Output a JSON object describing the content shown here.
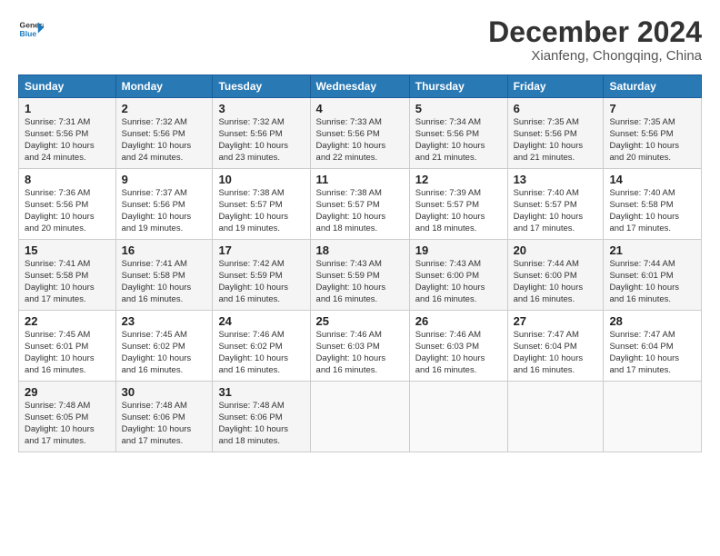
{
  "header": {
    "logo_line1": "General",
    "logo_line2": "Blue",
    "month": "December 2024",
    "location": "Xianfeng, Chongqing, China"
  },
  "days_of_week": [
    "Sunday",
    "Monday",
    "Tuesday",
    "Wednesday",
    "Thursday",
    "Friday",
    "Saturday"
  ],
  "weeks": [
    [
      {
        "day": "1",
        "lines": [
          "Sunrise: 7:31 AM",
          "Sunset: 5:56 PM",
          "Daylight: 10 hours",
          "and 24 minutes."
        ]
      },
      {
        "day": "2",
        "lines": [
          "Sunrise: 7:32 AM",
          "Sunset: 5:56 PM",
          "Daylight: 10 hours",
          "and 24 minutes."
        ]
      },
      {
        "day": "3",
        "lines": [
          "Sunrise: 7:32 AM",
          "Sunset: 5:56 PM",
          "Daylight: 10 hours",
          "and 23 minutes."
        ]
      },
      {
        "day": "4",
        "lines": [
          "Sunrise: 7:33 AM",
          "Sunset: 5:56 PM",
          "Daylight: 10 hours",
          "and 22 minutes."
        ]
      },
      {
        "day": "5",
        "lines": [
          "Sunrise: 7:34 AM",
          "Sunset: 5:56 PM",
          "Daylight: 10 hours",
          "and 21 minutes."
        ]
      },
      {
        "day": "6",
        "lines": [
          "Sunrise: 7:35 AM",
          "Sunset: 5:56 PM",
          "Daylight: 10 hours",
          "and 21 minutes."
        ]
      },
      {
        "day": "7",
        "lines": [
          "Sunrise: 7:35 AM",
          "Sunset: 5:56 PM",
          "Daylight: 10 hours",
          "and 20 minutes."
        ]
      }
    ],
    [
      {
        "day": "8",
        "lines": [
          "Sunrise: 7:36 AM",
          "Sunset: 5:56 PM",
          "Daylight: 10 hours",
          "and 20 minutes."
        ]
      },
      {
        "day": "9",
        "lines": [
          "Sunrise: 7:37 AM",
          "Sunset: 5:56 PM",
          "Daylight: 10 hours",
          "and 19 minutes."
        ]
      },
      {
        "day": "10",
        "lines": [
          "Sunrise: 7:38 AM",
          "Sunset: 5:57 PM",
          "Daylight: 10 hours",
          "and 19 minutes."
        ]
      },
      {
        "day": "11",
        "lines": [
          "Sunrise: 7:38 AM",
          "Sunset: 5:57 PM",
          "Daylight: 10 hours",
          "and 18 minutes."
        ]
      },
      {
        "day": "12",
        "lines": [
          "Sunrise: 7:39 AM",
          "Sunset: 5:57 PM",
          "Daylight: 10 hours",
          "and 18 minutes."
        ]
      },
      {
        "day": "13",
        "lines": [
          "Sunrise: 7:40 AM",
          "Sunset: 5:57 PM",
          "Daylight: 10 hours",
          "and 17 minutes."
        ]
      },
      {
        "day": "14",
        "lines": [
          "Sunrise: 7:40 AM",
          "Sunset: 5:58 PM",
          "Daylight: 10 hours",
          "and 17 minutes."
        ]
      }
    ],
    [
      {
        "day": "15",
        "lines": [
          "Sunrise: 7:41 AM",
          "Sunset: 5:58 PM",
          "Daylight: 10 hours",
          "and 17 minutes."
        ]
      },
      {
        "day": "16",
        "lines": [
          "Sunrise: 7:41 AM",
          "Sunset: 5:58 PM",
          "Daylight: 10 hours",
          "and 16 minutes."
        ]
      },
      {
        "day": "17",
        "lines": [
          "Sunrise: 7:42 AM",
          "Sunset: 5:59 PM",
          "Daylight: 10 hours",
          "and 16 minutes."
        ]
      },
      {
        "day": "18",
        "lines": [
          "Sunrise: 7:43 AM",
          "Sunset: 5:59 PM",
          "Daylight: 10 hours",
          "and 16 minutes."
        ]
      },
      {
        "day": "19",
        "lines": [
          "Sunrise: 7:43 AM",
          "Sunset: 6:00 PM",
          "Daylight: 10 hours",
          "and 16 minutes."
        ]
      },
      {
        "day": "20",
        "lines": [
          "Sunrise: 7:44 AM",
          "Sunset: 6:00 PM",
          "Daylight: 10 hours",
          "and 16 minutes."
        ]
      },
      {
        "day": "21",
        "lines": [
          "Sunrise: 7:44 AM",
          "Sunset: 6:01 PM",
          "Daylight: 10 hours",
          "and 16 minutes."
        ]
      }
    ],
    [
      {
        "day": "22",
        "lines": [
          "Sunrise: 7:45 AM",
          "Sunset: 6:01 PM",
          "Daylight: 10 hours",
          "and 16 minutes."
        ]
      },
      {
        "day": "23",
        "lines": [
          "Sunrise: 7:45 AM",
          "Sunset: 6:02 PM",
          "Daylight: 10 hours",
          "and 16 minutes."
        ]
      },
      {
        "day": "24",
        "lines": [
          "Sunrise: 7:46 AM",
          "Sunset: 6:02 PM",
          "Daylight: 10 hours",
          "and 16 minutes."
        ]
      },
      {
        "day": "25",
        "lines": [
          "Sunrise: 7:46 AM",
          "Sunset: 6:03 PM",
          "Daylight: 10 hours",
          "and 16 minutes."
        ]
      },
      {
        "day": "26",
        "lines": [
          "Sunrise: 7:46 AM",
          "Sunset: 6:03 PM",
          "Daylight: 10 hours",
          "and 16 minutes."
        ]
      },
      {
        "day": "27",
        "lines": [
          "Sunrise: 7:47 AM",
          "Sunset: 6:04 PM",
          "Daylight: 10 hours",
          "and 16 minutes."
        ]
      },
      {
        "day": "28",
        "lines": [
          "Sunrise: 7:47 AM",
          "Sunset: 6:04 PM",
          "Daylight: 10 hours",
          "and 17 minutes."
        ]
      }
    ],
    [
      {
        "day": "29",
        "lines": [
          "Sunrise: 7:48 AM",
          "Sunset: 6:05 PM",
          "Daylight: 10 hours",
          "and 17 minutes."
        ]
      },
      {
        "day": "30",
        "lines": [
          "Sunrise: 7:48 AM",
          "Sunset: 6:06 PM",
          "Daylight: 10 hours",
          "and 17 minutes."
        ]
      },
      {
        "day": "31",
        "lines": [
          "Sunrise: 7:48 AM",
          "Sunset: 6:06 PM",
          "Daylight: 10 hours",
          "and 18 minutes."
        ]
      },
      {
        "day": "",
        "lines": []
      },
      {
        "day": "",
        "lines": []
      },
      {
        "day": "",
        "lines": []
      },
      {
        "day": "",
        "lines": []
      }
    ]
  ]
}
